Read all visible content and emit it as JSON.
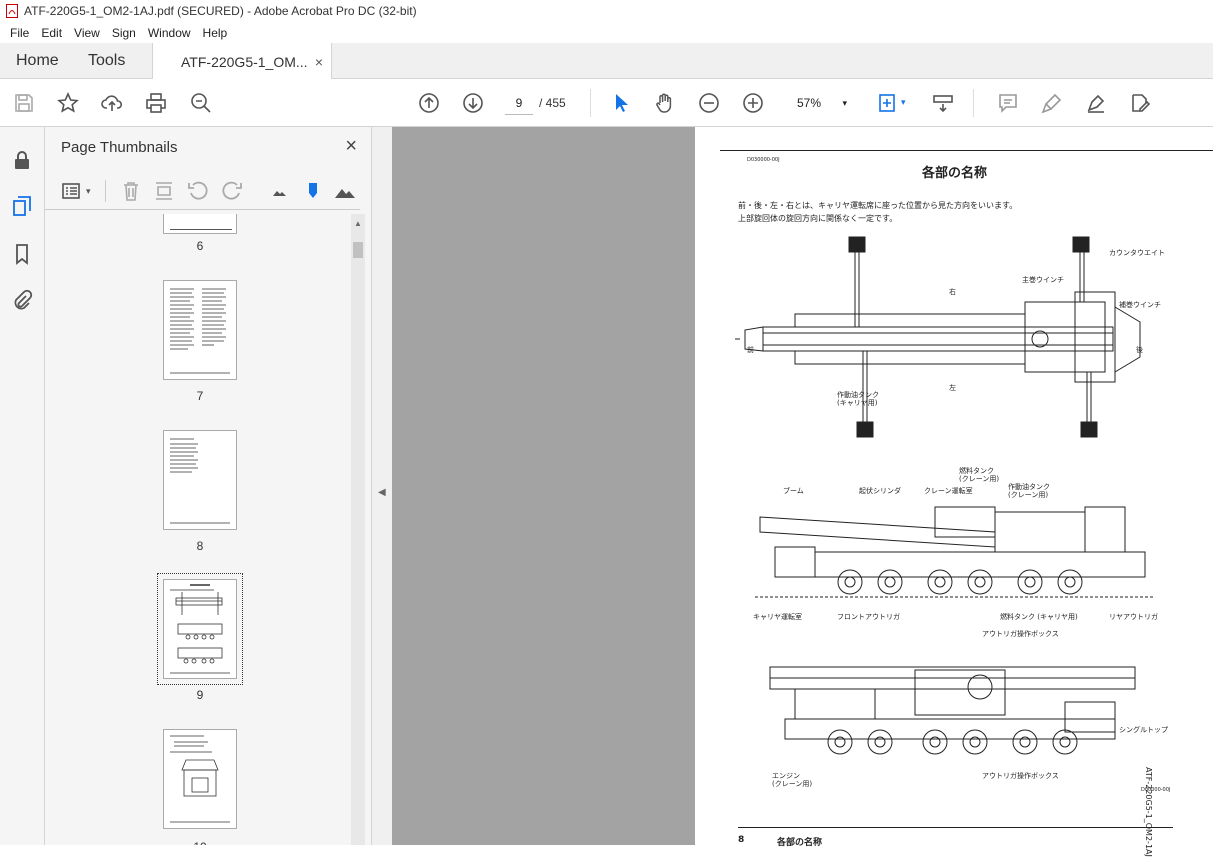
{
  "window": {
    "title": "ATF-220G5-1_OM2-1AJ.pdf (SECURED) - Adobe Acrobat Pro DC (32-bit)"
  },
  "menu": [
    "File",
    "Edit",
    "View",
    "Sign",
    "Window",
    "Help"
  ],
  "tabs": {
    "home": "Home",
    "tools": "Tools",
    "doc": "ATF-220G5-1_OM...",
    "doc_close": "×"
  },
  "toolbar": {
    "page_current": "9",
    "page_total": "/ 455",
    "zoom": "57%",
    "zoom_arrow": "▾"
  },
  "panel": {
    "title": "Page Thumbnails",
    "close": "×"
  },
  "thumbnails": [
    {
      "label": "6"
    },
    {
      "label": "7"
    },
    {
      "label": "8"
    },
    {
      "label": "9",
      "selected": true
    },
    {
      "label": "10"
    }
  ],
  "document": {
    "code": "D030000-00J",
    "title": "各部の名称",
    "intro_1": "前・後・左・右とは、キャリヤ運転席に座った位置から見た方向をいいます。",
    "intro_2": "上部旋回体の旋回方向に関係なく一定です。",
    "dir_front": "前",
    "dir_rear": "後",
    "dir_right": "右",
    "dir_left": "左",
    "lbl_counterweight": "カウンタウエイト",
    "lbl_main_winch": "主巻ウインチ",
    "lbl_aux_winch": "補巻ウインチ",
    "lbl_hyd_tank_carrier": "作動油タンク",
    "lbl_hyd_tank_carrier_2": "(キャリヤ用)",
    "lbl_fuel_tank_crane": "燃料タンク",
    "lbl_fuel_tank_crane_2": "(クレーン用)",
    "lbl_hyd_tank_crane": "作動油タンク",
    "lbl_hyd_tank_crane_2": "(クレーン用)",
    "lbl_boom": "ブーム",
    "lbl_derrick_cyl": "起伏シリンダ",
    "lbl_crane_cab": "クレーン運転室",
    "lbl_carrier_cab": "キャリヤ運転室",
    "lbl_front_outrigger": "フロントアウトリガ",
    "lbl_fuel_tank_carrier": "燃料タンク (キャリヤ用)",
    "lbl_rear_outrigger": "リヤアウトリガ",
    "lbl_outrigger_box": "アウトリガ操作ボックス",
    "lbl_single_top": "シングルトップ",
    "lbl_engine": "エンジン",
    "lbl_engine_2": "(クレーン用)",
    "lbl_outrigger_box_2": "アウトリガ操作ボックス",
    "fig_code": "D00000-00J",
    "side_text": "ATF-220G5-1_OM2-1AJ",
    "footer_page": "8",
    "footer_title": "各部の名称"
  }
}
